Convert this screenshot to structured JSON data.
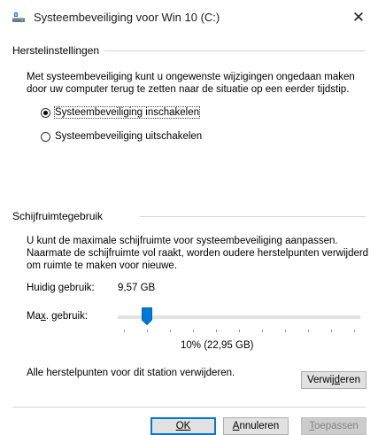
{
  "window": {
    "title": "Systeembeveiliging voor Win 10 (C:)",
    "close_glyph": "✕",
    "icon": "drive-restore-icon"
  },
  "restore_settings": {
    "group_title": "Herstelinstellingen",
    "description_line1": "Met systeembeveiliging kunt u ongewenste wijzigingen ongedaan maken",
    "description_line2": "door uw computer terug te zetten naar de situatie op een eerder tijdstip.",
    "options": [
      {
        "label": "Systeembeveiliging inschakelen",
        "selected": true
      },
      {
        "label": "Systeembeveiliging uitschakelen",
        "selected": false
      }
    ]
  },
  "disk_usage": {
    "group_title": "Schijfruimtegebruik",
    "description_line1": "U kunt de maximale schijfruimte voor systeembeveiliging aanpassen.",
    "description_line2": "Naarmate de schijfruimte vol raakt, worden oudere herstelpunten verwijderd",
    "description_line3": "om ruimte te maken voor nieuwe.",
    "current_label": "Huidig gebruik:",
    "current_value": "9,57 GB",
    "max_label_pre": "Ma",
    "max_label_ul": "x",
    "max_label_post": ". gebruik:",
    "slider_value_text": "10% (22,95 GB)",
    "slider_fraction": 0.1,
    "delete_text": "Alle herstelpunten voor dit station verwijderen.",
    "delete_button_pre": "Verwij",
    "delete_button_ul": "d",
    "delete_button_post": "eren"
  },
  "buttons": {
    "ok_label": "OK",
    "cancel_ul": "A",
    "cancel_rest": "nnuleren",
    "apply_ul": "T",
    "apply_rest": "oepassen"
  },
  "colors": {
    "accent": "#0078d7",
    "button_face": "#e1e1e1",
    "disabled_text": "#838383"
  }
}
